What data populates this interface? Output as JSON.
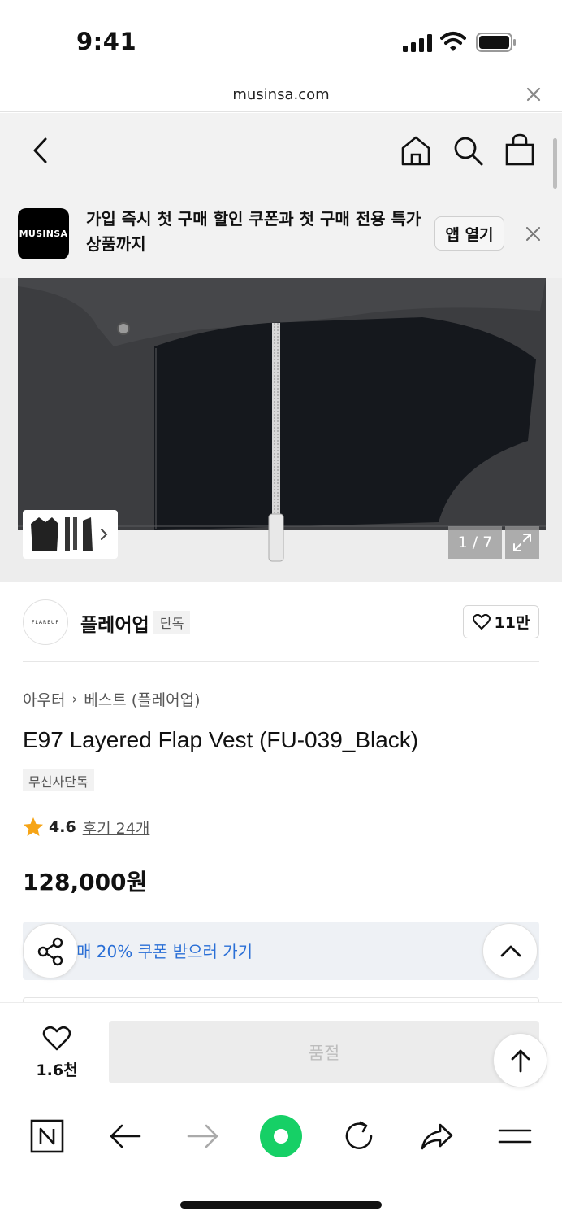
{
  "status_bar": {
    "time": "9:41"
  },
  "browser": {
    "url": "musinsa.com"
  },
  "icons": {
    "back": "chevron-left-icon",
    "home": "home-icon",
    "search": "search-icon",
    "bag": "shopping-bag-icon",
    "close": "close-icon",
    "heart": "heart-icon",
    "share": "share-icon",
    "star": "star-icon"
  },
  "app_banner": {
    "logo_text": "MUSINSA",
    "message": "가입 즉시 첫 구매 할인 쿠폰과 첫 구매 전용 특가 상품까지",
    "open_label": "앱 열기"
  },
  "gallery": {
    "page_indicator": "1 / 7"
  },
  "brand": {
    "logo_text": "FLAREUP",
    "name": "플레어업",
    "tag": "단독",
    "likes": "11만"
  },
  "product": {
    "breadcrumb": [
      "아우터",
      "베스트 (플레어업)"
    ],
    "title": "E97 Layered Flap Vest (FU-039_Black)",
    "badge": "무신사단독",
    "rating": "4.6",
    "reviews": "후기 24개",
    "price": "128,000원"
  },
  "coupon": {
    "text": "매 20% 쿠폰 받으러 가기"
  },
  "purchase_bar": {
    "wish_count": "1.6천",
    "buy_label": "품절"
  },
  "colors": {
    "accent_blue": "#2a6fd6",
    "star": "#f6a416",
    "green": "#16d066"
  }
}
